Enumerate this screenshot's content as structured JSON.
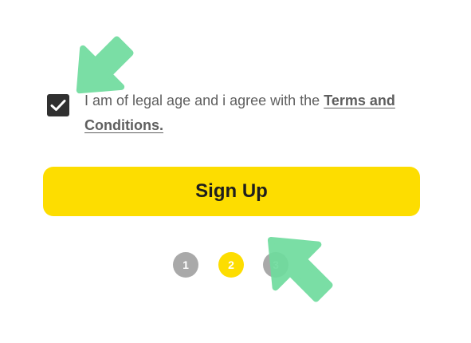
{
  "consent": {
    "checked": true,
    "text_before": "I am of legal age and i agree with the ",
    "terms_link": "Terms and Conditions."
  },
  "signup_button": {
    "label": "Sign Up"
  },
  "steps": [
    {
      "label": "1",
      "state": "inactive"
    },
    {
      "label": "2",
      "state": "active"
    },
    {
      "label": "3",
      "state": "inactive"
    }
  ],
  "colors": {
    "accent_yellow": "#fddd00",
    "checkbox_dark": "#303030",
    "inactive_gray": "#a9a9a9",
    "pointer_arrow_green": "#6fdc9e",
    "text_gray": "#5f5f5f"
  }
}
